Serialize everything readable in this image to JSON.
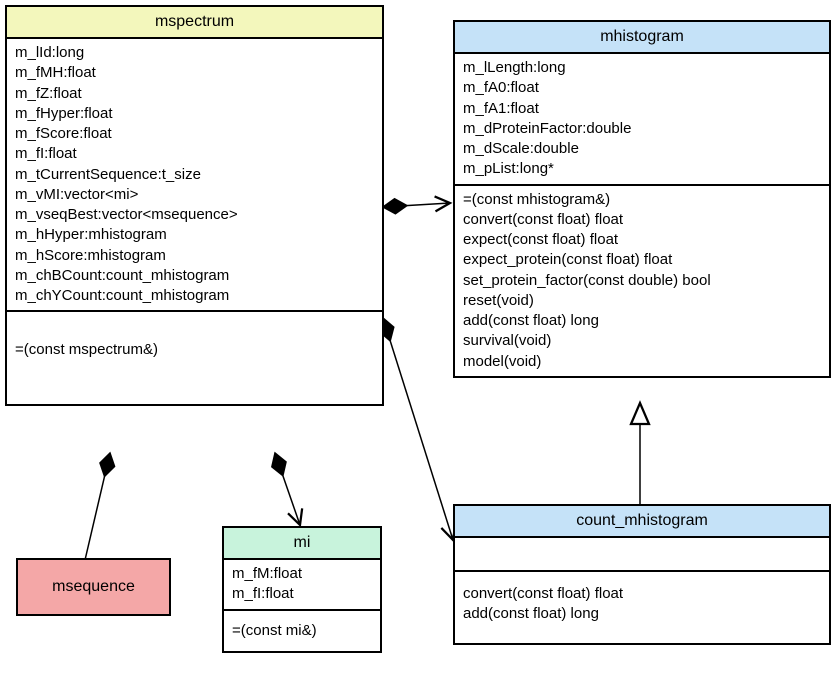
{
  "classes": {
    "mspectrum": {
      "name": "mspectrum",
      "attributes": [
        "m_lId:long",
        "m_fMH:float",
        "m_fZ:float",
        "m_fHyper:float",
        "m_fScore:float",
        "m_fI:float",
        "m_tCurrentSequence:t_size",
        "m_vMI:vector<mi>",
        "m_vseqBest:vector<msequence>",
        "m_hHyper:mhistogram",
        "m_hScore:mhistogram",
        "m_chBCount:count_mhistogram",
        "m_chYCount:count_mhistogram"
      ],
      "operations": [
        "=(const mspectrum&)"
      ]
    },
    "mhistogram": {
      "name": "mhistogram",
      "attributes": [
        "m_lLength:long",
        "m_fA0:float",
        "m_fA1:float",
        "m_dProteinFactor:double",
        "m_dScale:double",
        "m_pList:long*"
      ],
      "operations": [
        "=(const mhistogram&)",
        "convert(const float) float",
        "expect(const float) float",
        "expect_protein(const float) float",
        "set_protein_factor(const double) bool",
        "reset(void)",
        "add(const float) long",
        "survival(void)",
        "model(void)"
      ]
    },
    "count_mhistogram": {
      "name": "count_mhistogram",
      "attributes": [],
      "operations": [
        "convert(const float) float",
        "add(const float) long"
      ]
    },
    "mi": {
      "name": "mi",
      "attributes": [
        "m_fM:float",
        "m_fI:float"
      ],
      "operations": [
        "=(const mi&)"
      ]
    },
    "msequence": {
      "name": "msequence",
      "attributes": [],
      "operations": []
    }
  }
}
